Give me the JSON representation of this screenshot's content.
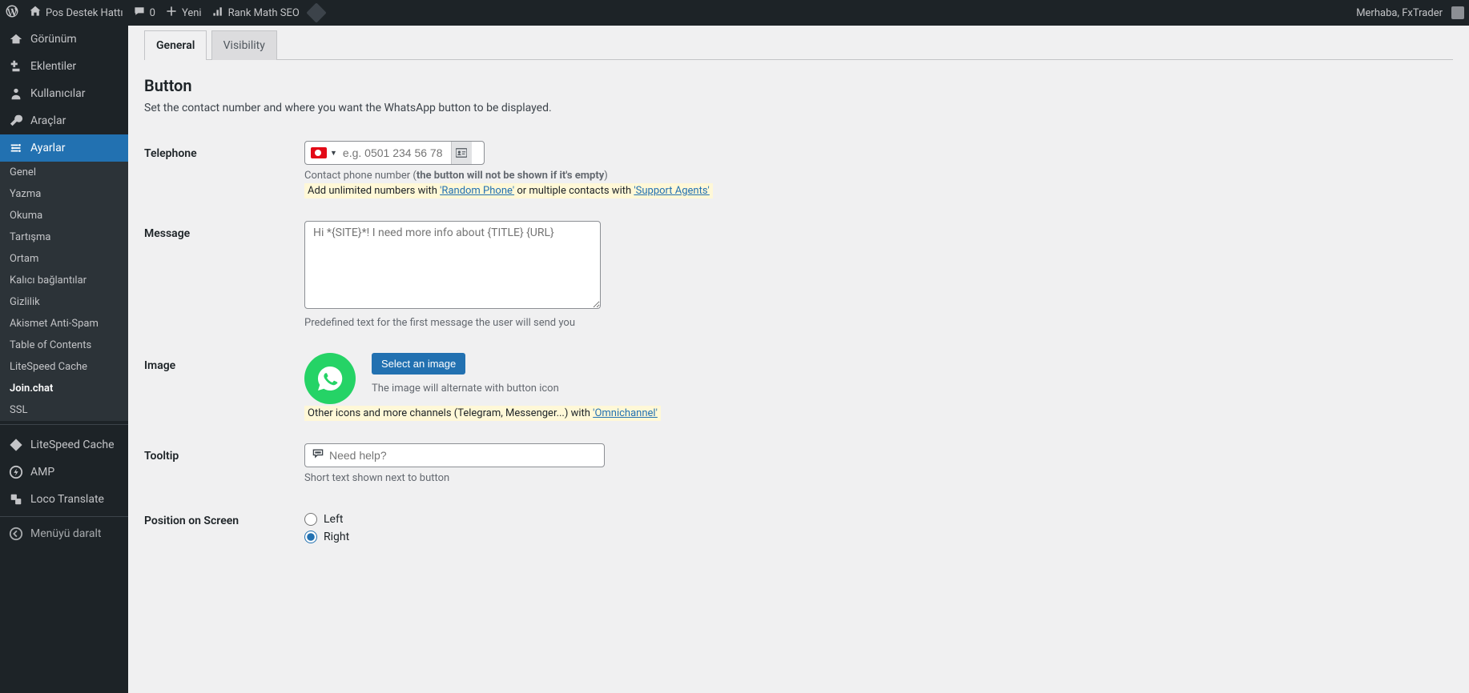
{
  "adminbar": {
    "site_name": "Pos Destek Hattı",
    "comments_count": "0",
    "new_label": "Yeni",
    "rankmath_label": "Rank Math SEO",
    "greeting": "Merhaba, FxTrader"
  },
  "sidebar": {
    "gorunum": "Görünüm",
    "eklentiler": "Eklentiler",
    "kullanicilar": "Kullanıcılar",
    "araclar": "Araçlar",
    "ayarlar": "Ayarlar",
    "submenu": {
      "genel": "Genel",
      "yazma": "Yazma",
      "okuma": "Okuma",
      "tartisma": "Tartışma",
      "ortam": "Ortam",
      "kalici": "Kalıcı bağlantılar",
      "gizlilik": "Gizlilik",
      "akismet": "Akismet Anti-Spam",
      "toc": "Table of Contents",
      "lscache": "LiteSpeed Cache",
      "joinchat": "Join.chat",
      "ssl": "SSL"
    },
    "lscache": "LiteSpeed Cache",
    "amp": "AMP",
    "loco": "Loco Translate",
    "collapse": "Menüyü daralt"
  },
  "tabs": {
    "general": "General",
    "visibility": "Visibility"
  },
  "section": {
    "title": "Button",
    "desc": "Set the contact number and where you want the WhatsApp button to be displayed."
  },
  "telephone": {
    "label": "Telephone",
    "placeholder": "e.g. 0501 234 56 78",
    "desc_prefix": "Contact phone number (",
    "desc_bold": "the button will not be shown if it's empty",
    "desc_suffix": ")",
    "hl_prefix": "Add unlimited numbers with ",
    "hl_link1": "'Random Phone'",
    "hl_mid": " or multiple contacts with ",
    "hl_link2": "'Support Agents'"
  },
  "message": {
    "label": "Message",
    "placeholder": "Hi *{SITE}*! I need more info about {TITLE} {URL}",
    "desc": "Predefined text for the first message the user will send you"
  },
  "image": {
    "label": "Image",
    "button": "Select an image",
    "desc1": "The image will alternate with button icon",
    "hl_prefix": "Other icons and more channels (Telegram, Messenger...) with ",
    "hl_link": "'Omnichannel'"
  },
  "tooltip": {
    "label": "Tooltip",
    "placeholder": "Need help?",
    "desc": "Short text shown next to button"
  },
  "position": {
    "label": "Position on Screen",
    "left": "Left",
    "right": "Right"
  }
}
